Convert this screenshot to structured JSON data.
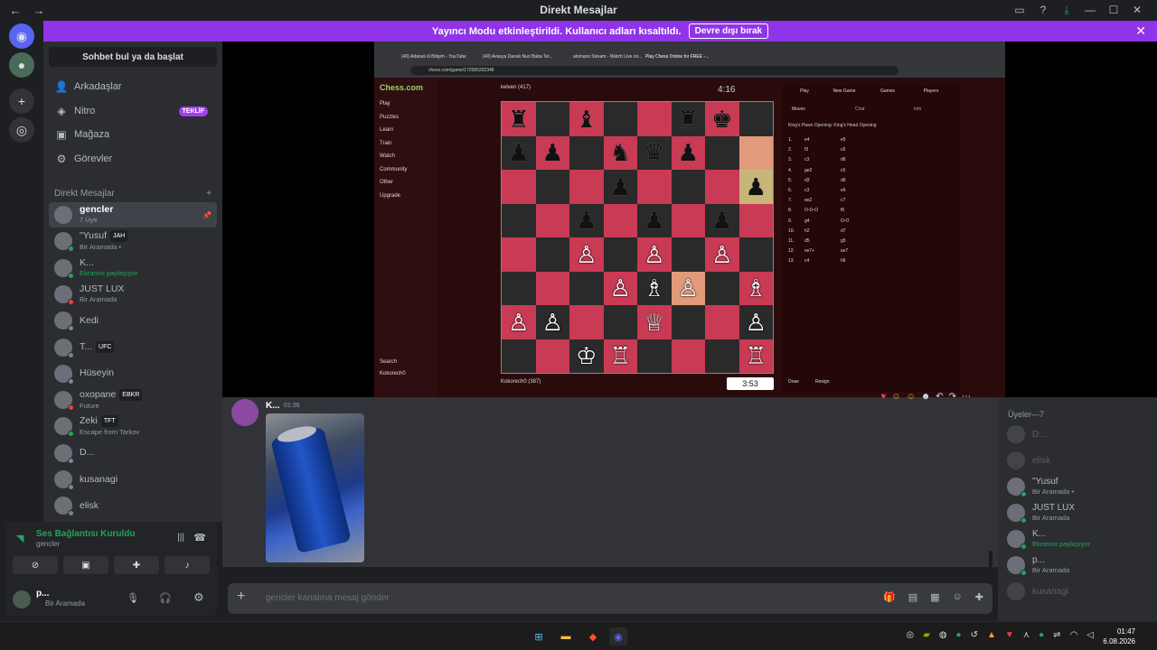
{
  "window": {
    "title": "Direkt Mesajlar"
  },
  "banner": {
    "text": "Yayıncı Modu etkinleştirildi. Kullanıcı adları kısaltıldı.",
    "button": "Devre dışı bırak"
  },
  "sidebar": {
    "search": "Sohbet bul ya da başlat",
    "nav": [
      {
        "label": "Arkadaşlar",
        "icon": "friends-icon"
      },
      {
        "label": "Nitro",
        "icon": "nitro-icon",
        "badge": "TEKLİF"
      },
      {
        "label": "Mağaza",
        "icon": "store-icon"
      },
      {
        "label": "Görevler",
        "icon": "quests-icon"
      }
    ],
    "dm_header": "Direkt Mesajlar",
    "dms": [
      {
        "name": "gencler",
        "sub": "7 Üye",
        "active": true
      },
      {
        "name": "\"Yusuf",
        "tag": "JAH",
        "sub": "Bir Aramada •",
        "status": "on"
      },
      {
        "name": "K...",
        "sub": "Ekranını paylaşıyor",
        "sub_green": true,
        "status": "on"
      },
      {
        "name": "JUST LUX",
        "sub": "Bir Aramada",
        "status": "dnd"
      },
      {
        "name": "Kedi",
        "sub": "",
        "status": "off"
      },
      {
        "name": "T...",
        "tag": "UFC",
        "sub": "",
        "status": "off"
      },
      {
        "name": "Hüseyin",
        "sub": "",
        "status": "off"
      },
      {
        "name": "oxopane",
        "tag": "EBKR",
        "sub": "Future",
        "status": "dnd"
      },
      {
        "name": "Zeki",
        "tag": "TFT",
        "sub": "Escape from Tarkov",
        "status": "on"
      },
      {
        "name": "D...",
        "sub": "",
        "status": "off"
      },
      {
        "name": "kusanagi",
        "sub": "",
        "status": "off"
      },
      {
        "name": "elisk",
        "sub": "",
        "status": "off"
      }
    ]
  },
  "voice": {
    "title": "Ses Bağlantısı Kuruldu",
    "channel": "gencler"
  },
  "user": {
    "name": "p...",
    "status": "Bir Aramada"
  },
  "chess": {
    "tabs": [
      "(40) Adanalı ili Bitişim - YouTube",
      "(40) Avasya Danalı Nuri Baba Tel...",
      "alomanx Stream - Watch Live on...",
      "Play Chess Online for FREE -..."
    ],
    "url": "chess.com/game/172585202348",
    "nav": [
      "Play",
      "Puzzles",
      "Learn",
      "Train",
      "Watch",
      "Community",
      "Other",
      "Upgrade",
      "Search",
      "Kokorech0"
    ],
    "top_player": "kelven (417)",
    "bottom_player": "Kokorech0 (387)",
    "clock_top": "4:16",
    "clock_bottom": "3:53",
    "panel_tabs": [
      "Play",
      "New Game",
      "Games",
      "Players"
    ],
    "subtabs": [
      "Moves",
      "Chat",
      "Info"
    ],
    "opening": "King's Pawn Opening: King's Head Opening",
    "moves": [
      [
        "1.",
        "e4",
        "e5"
      ],
      [
        "2.",
        "f3",
        "c6"
      ],
      [
        "3.",
        "c3",
        "d6"
      ],
      [
        "4.",
        "ge2",
        "c5"
      ],
      [
        "5.",
        "d3",
        "d6"
      ],
      [
        "6.",
        "c3",
        "e6"
      ],
      [
        "7.",
        "ee2",
        "c7"
      ],
      [
        "8.",
        "O-O-O",
        "f6"
      ],
      [
        "9.",
        "g4",
        "O-O"
      ],
      [
        "10.",
        "h2",
        "d7"
      ],
      [
        "11.",
        "d5",
        "g5"
      ],
      [
        "12.",
        "xe7+",
        "xe7"
      ],
      [
        "13.",
        "c4",
        "h6"
      ]
    ],
    "footer": [
      "Draw",
      "Resign"
    ]
  },
  "message": {
    "author": "K...",
    "time": "01:36"
  },
  "composer": {
    "placeholder": "gencler kanalına mesaj gönder"
  },
  "members": {
    "header": "Üyeler—7",
    "list": [
      {
        "name": "D...",
        "sub": "",
        "off": true
      },
      {
        "name": "elisk",
        "sub": "",
        "off": true
      },
      {
        "name": "\"Yusuf",
        "sub": "Bir Aramada •",
        "off": false
      },
      {
        "name": "JUST LUX",
        "sub": "Bir Aramada",
        "off": false
      },
      {
        "name": "K...",
        "sub": "Ekranını paylaşıyor",
        "green": true,
        "off": false
      },
      {
        "name": "p...",
        "sub": "Bir Aramada",
        "off": false
      },
      {
        "name": "kusanagi",
        "sub": "",
        "off": true
      }
    ]
  },
  "taskbar": {
    "time": "01:47",
    "date": "6.08.2026"
  }
}
